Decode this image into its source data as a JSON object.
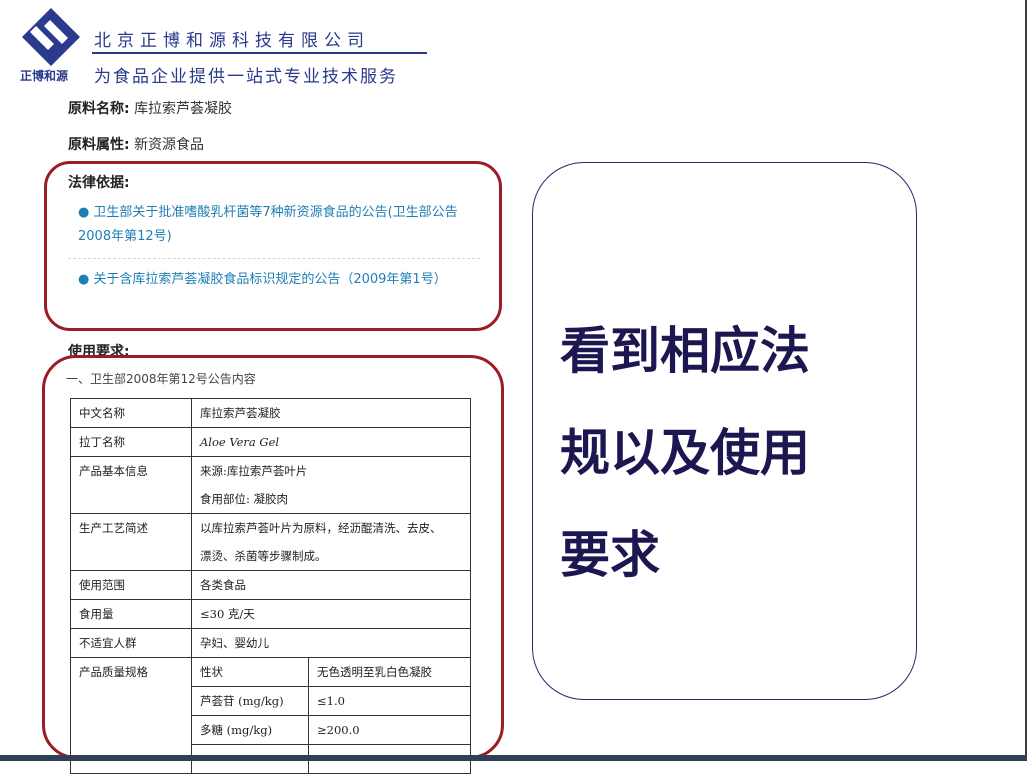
{
  "header": {
    "company_name": "北京正博和源科技有限公司",
    "logo_text": "正博和源",
    "slogan": "为食品企业提供一站式专业技术服务"
  },
  "fields": {
    "material_name_label": "原料名称:",
    "material_name_value": "库拉索芦荟凝胶",
    "material_attr_label": "原料属性:",
    "material_attr_value": "新资源食品"
  },
  "law": {
    "title": "法律依据:",
    "items": [
      "卫生部关于批准嗜酸乳杆菌等7种新资源食品的公告(卫生部公告2008年第12号)",
      "关于含库拉索芦荟凝胶食品标识规定的公告（2009年第1号）"
    ]
  },
  "usage": {
    "title": "使用要求:",
    "subtitle": "一、卫生部2008年第12号公告内容"
  },
  "table": {
    "chinese_name_label": "中文名称",
    "chinese_name_value": "库拉索芦荟凝胶",
    "latin_name_label": "拉丁名称",
    "latin_name_value": "Aloe Vera Gel",
    "basic_info_label": "产品基本信息",
    "basic_info_line1": "来源:库拉索芦荟叶片",
    "basic_info_line2": "食用部位: 凝胶肉",
    "process_label": "生产工艺简述",
    "process_line1": "以库拉索芦荟叶片为原料，经沥醌清洗、去皮、",
    "process_line2": "漂烫、杀菌等步骤制成。",
    "scope_label": "使用范围",
    "scope_value": "各类食品",
    "dosage_label": "食用量",
    "dosage_value": "≤30 克/天",
    "unsuitable_label": "不适宜人群",
    "unsuitable_value": "孕妇、婴幼儿",
    "quality_label": "产品质量规格",
    "quality_rows": [
      {
        "k": "性状",
        "v": "无色透明至乳白色凝胶"
      },
      {
        "k": "芦荟苷 (mg/kg)",
        "v": "≤1.0"
      },
      {
        "k": "多糖 (mg/kg)",
        "v": "≥200.0"
      }
    ]
  },
  "callout": {
    "line1": "看到相应法",
    "line2": "规以及使用",
    "line3": "要求"
  }
}
